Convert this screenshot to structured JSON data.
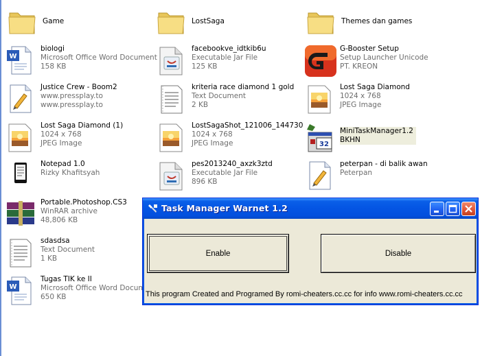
{
  "files": [
    {
      "name": "Game",
      "lines": [],
      "icon": "folder-icon"
    },
    {
      "name": "LostSaga",
      "lines": [],
      "icon": "folder-icon"
    },
    {
      "name": "Themes dan games",
      "lines": [],
      "icon": "folder-icon"
    },
    {
      "name": "biologi",
      "lines": [
        "Microsoft Office Word Document",
        "158 KB"
      ],
      "icon": "word-document-icon"
    },
    {
      "name": "facebookve_idtkib6u",
      "lines": [
        "Executable Jar File",
        "125 KB"
      ],
      "icon": "java-jar-icon"
    },
    {
      "name": "G-Booster Setup",
      "lines": [
        "Setup Launcher Unicode",
        "PT. KREON"
      ],
      "icon": "gbooster-setup-icon"
    },
    {
      "name": "Justice Crew - Boom2",
      "lines": [
        "www.pressplay.to",
        "www.pressplay.to"
      ],
      "icon": "shortcut-document-icon"
    },
    {
      "name": "kriteria race diamond 1 gold",
      "lines": [
        "Text Document",
        "2 KB"
      ],
      "icon": "text-document-icon"
    },
    {
      "name": "Lost Saga Diamond",
      "lines": [
        "1024 x 768",
        "JPEG Image"
      ],
      "icon": "jpeg-image-icon"
    },
    {
      "name": "Lost Saga Diamond (1)",
      "lines": [
        "1024 x 768",
        "JPEG Image"
      ],
      "icon": "jpeg-image-icon"
    },
    {
      "name": "LostSagaShot_121006_144730",
      "lines": [
        "1024 x 768",
        "JPEG Image"
      ],
      "icon": "jpeg-image-icon"
    },
    {
      "name": "MiniTaskManager1.2",
      "lines": [
        "BKHN"
      ],
      "icon": "mini-task-manager-icon"
    },
    {
      "name": "Notepad 1.0",
      "lines": [
        "Rizky Khafitsyah"
      ],
      "icon": "notepad-app-icon"
    },
    {
      "name": "pes2013240_axzk3ztd",
      "lines": [
        "Executable Jar File",
        "896 KB"
      ],
      "icon": "java-jar-icon"
    },
    {
      "name": "peterpan - di balik awan",
      "lines": [
        "Peterpan"
      ],
      "icon": "shortcut-document-icon"
    },
    {
      "name": "Portable.Photoshop.CS3",
      "lines": [
        "WinRAR archive",
        "48,806 KB"
      ],
      "icon": "winrar-archive-icon"
    },
    {
      "name": "sdasdsa",
      "lines": [
        "Text Document",
        "1 KB"
      ],
      "icon": "text-document-icon"
    },
    {
      "name": "Tugas TIK ke II",
      "lines": [
        "Microsoft Office Word Document",
        "650 KB"
      ],
      "icon": "word-document-icon"
    }
  ],
  "dialog": {
    "title": "Task Manager Warnet 1.2",
    "enable_label": "Enable",
    "disable_label": "Disable",
    "credit_text": "This program Created and Programed By romi-cheaters.cc.cc for info www.romi-cheaters.cc.cc"
  },
  "colors": {
    "titlebar": "#0455e3",
    "window_face": "#ece9d8",
    "close_button": "#e0573a",
    "secondary_text": "#6d6d6d"
  }
}
